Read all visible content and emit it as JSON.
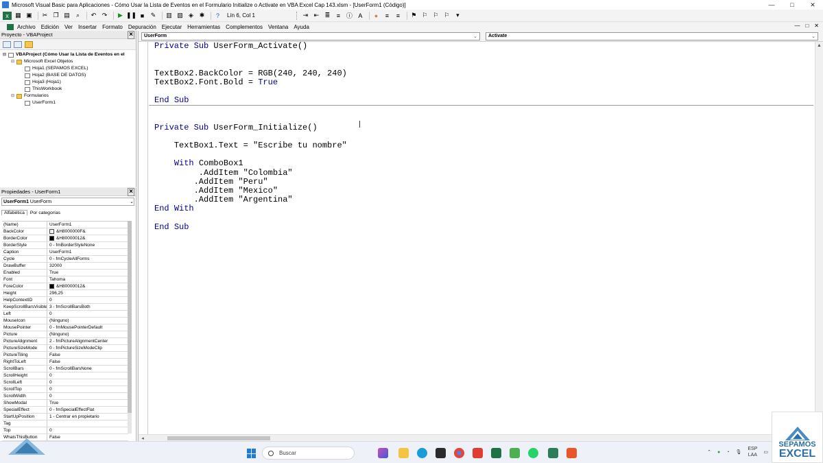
{
  "window": {
    "title": "Microsoft Visual Basic para Aplicaciones - Cómo Usar la Lista de Eventos en el Formulario Initialize o Activate en VBA Excel Cap 143.xlsm - [UserForm1 (Código)]",
    "controls": [
      "—",
      "□",
      "✕"
    ]
  },
  "toolbar": {
    "status": "Lín 6, Col 1"
  },
  "menu": {
    "items": [
      "Archivo",
      "Edición",
      "Ver",
      "Insertar",
      "Formato",
      "Depuración",
      "Ejecutar",
      "Herramientas",
      "Complementos",
      "Ventana",
      "Ayuda"
    ],
    "right_controls": [
      "—",
      "□",
      "✕"
    ]
  },
  "project": {
    "title": "Proyecto - VBAProject",
    "tree": [
      {
        "label": "VBAProject (Cómo Usar la Lista de Eventos en el",
        "level": 0,
        "bold": true
      },
      {
        "label": "Microsoft Excel Objetos",
        "level": 1
      },
      {
        "label": "Hoja1 (SEPAMOS EXCEL)",
        "level": 2
      },
      {
        "label": "Hoja2 (BASE DE DATOS)",
        "level": 2
      },
      {
        "label": "Hoja3 (Hoja1)",
        "level": 2
      },
      {
        "label": "ThisWorkbook",
        "level": 2
      },
      {
        "label": "Formularios",
        "level": 1
      },
      {
        "label": "UserForm1",
        "level": 2
      }
    ]
  },
  "properties": {
    "title": "Propiedades - UserForm1",
    "object_bold": "UserForm1",
    "object_type": "UserForm",
    "tabs": [
      "Alfabética",
      "Por categorías"
    ],
    "rows": [
      {
        "name": "(Name)",
        "value": "UserForm1"
      },
      {
        "name": "BackColor",
        "value": "&H8000000F&",
        "swatch": "#f0f0f0"
      },
      {
        "name": "BorderColor",
        "value": "&H80000012&",
        "swatch": "#000000"
      },
      {
        "name": "BorderStyle",
        "value": "0 - fmBorderStyleNone"
      },
      {
        "name": "Caption",
        "value": "UserForm1"
      },
      {
        "name": "Cycle",
        "value": "0 - fmCycleAllForms"
      },
      {
        "name": "DrawBuffer",
        "value": "32000"
      },
      {
        "name": "Enabled",
        "value": "True"
      },
      {
        "name": "Font",
        "value": "Tahoma"
      },
      {
        "name": "ForeColor",
        "value": "&H80000012&",
        "swatch": "#000000"
      },
      {
        "name": "Height",
        "value": "296,25"
      },
      {
        "name": "HelpContextID",
        "value": "0"
      },
      {
        "name": "KeepScrollBarsVisible",
        "value": "3 - fmScrollBarsBoth"
      },
      {
        "name": "Left",
        "value": "0"
      },
      {
        "name": "MouseIcon",
        "value": "(Ninguno)"
      },
      {
        "name": "MousePointer",
        "value": "0 - fmMousePointerDefault"
      },
      {
        "name": "Picture",
        "value": "(Ninguno)"
      },
      {
        "name": "PictureAlignment",
        "value": "2 - fmPictureAlignmentCenter"
      },
      {
        "name": "PictureSizeMode",
        "value": "0 - fmPictureSizeModeClip"
      },
      {
        "name": "PictureTiling",
        "value": "False"
      },
      {
        "name": "RightToLeft",
        "value": "False"
      },
      {
        "name": "ScrollBars",
        "value": "0 - fmScrollBarsNone"
      },
      {
        "name": "ScrollHeight",
        "value": "0"
      },
      {
        "name": "ScrollLeft",
        "value": "0"
      },
      {
        "name": "ScrollTop",
        "value": "0"
      },
      {
        "name": "ScrollWidth",
        "value": "0"
      },
      {
        "name": "ShowModal",
        "value": "True"
      },
      {
        "name": "SpecialEffect",
        "value": "0 - fmSpecialEffectFlat"
      },
      {
        "name": "StartUpPosition",
        "value": "1 - Centrar en propietario"
      },
      {
        "name": "Tag",
        "value": ""
      },
      {
        "name": "Top",
        "value": "0"
      },
      {
        "name": "WhatsThisButton",
        "value": "False"
      }
    ]
  },
  "code": {
    "object_combo": "UserForm",
    "proc_combo": "Activate",
    "lines": [
      "Private Sub UserForm_Activate()",
      "",
      "",
      "TextBox2.BackColor = RGB(240, 240, 240)",
      "TextBox2.Font.Bold = True",
      "",
      "End Sub",
      "",
      "",
      "Private Sub UserForm_Initialize()",
      "",
      "    TextBox1.Text = \"Escribe tu nombre\"",
      "",
      "    With ComboBox1",
      "         .AddItem \"Colombia\"",
      "        .AddItem \"Peru\"",
      "        .AddItem \"Mexico\"",
      "        .AddItem \"Argentina\"",
      "End With",
      "",
      "End Sub"
    ]
  },
  "taskbar": {
    "search_placeholder": "Buscar",
    "lang_top": "ESP",
    "lang_bottom": "LAA"
  },
  "branding": {
    "line1": "SEPAMOS",
    "line2": "EXCEL"
  },
  "colors": {
    "keyword": "#00008b",
    "excel_green": "#1f7244"
  }
}
